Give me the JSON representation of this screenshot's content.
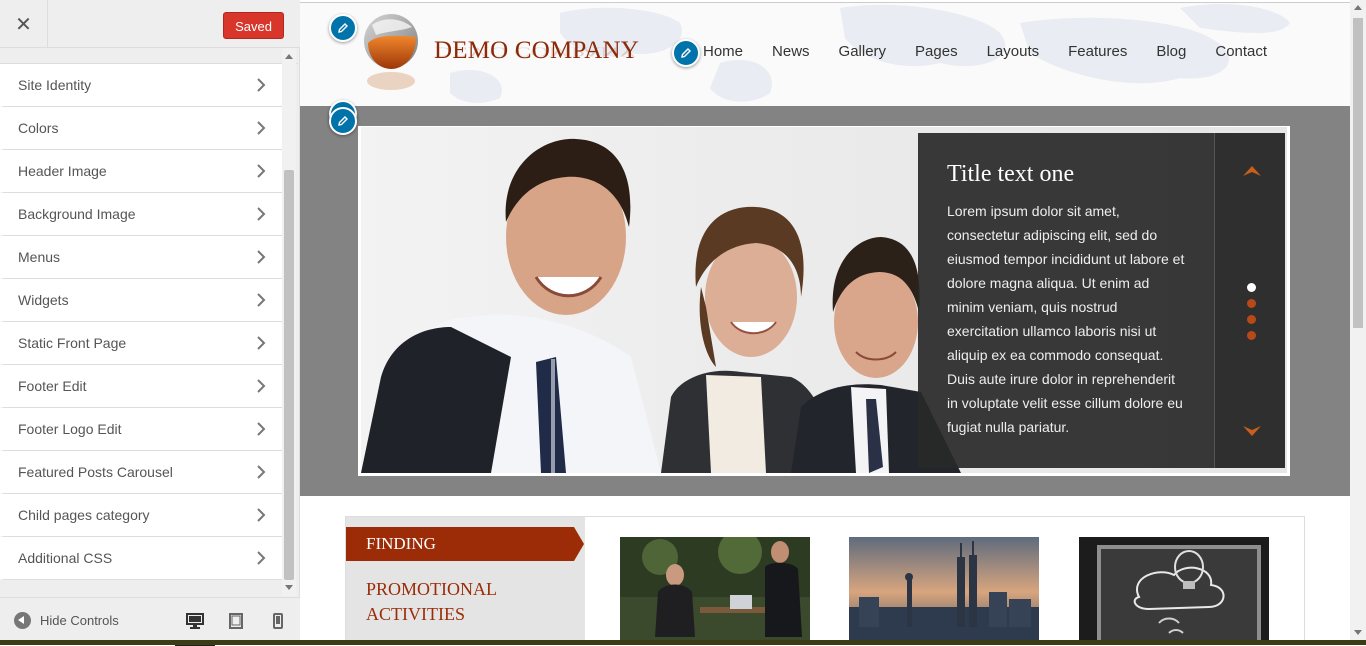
{
  "customizer": {
    "close_icon": "close-icon",
    "status_label": "Saved",
    "menu": [
      {
        "label": "Site Identity"
      },
      {
        "label": "Colors"
      },
      {
        "label": "Header Image"
      },
      {
        "label": "Background Image"
      },
      {
        "label": "Menus"
      },
      {
        "label": "Widgets"
      },
      {
        "label": "Static Front Page"
      },
      {
        "label": "Footer Edit"
      },
      {
        "label": "Footer Logo Edit"
      },
      {
        "label": "Featured Posts Carousel"
      },
      {
        "label": "Child pages category"
      },
      {
        "label": "Additional CSS"
      }
    ],
    "hide_controls_label": "Hide Controls",
    "devices": [
      "desktop-icon",
      "tablet-icon",
      "mobile-icon"
    ]
  },
  "site": {
    "logo_text": "DEMO COMPANY",
    "nav": [
      "Home",
      "News",
      "Gallery",
      "Pages",
      "Layouts",
      "Features",
      "Blog",
      "Contact"
    ],
    "slider": {
      "title": "Title text one",
      "text": "Lorem ipsum dolor sit amet, consectetur adipiscing elit, sed do eiusmod tempor incididunt ut labore et dolore magna aliqua. Ut enim ad minim veniam, quis nostrud exercitation ullamco laboris nisi ut aliquip ex ea commodo consequat. Duis aute irure dolor in reprehenderit in voluptate velit esse cillum dolore eu fugiat nulla pariatur."
    },
    "finding_label": "FINDING",
    "promo_label": "PROMOTIONAL ACTIVITIES"
  },
  "colors": {
    "brand": "#8b2a08",
    "accent_orange": "#c85f1a",
    "saved_red": "#d9362b",
    "edit_blue": "#0073aa"
  }
}
